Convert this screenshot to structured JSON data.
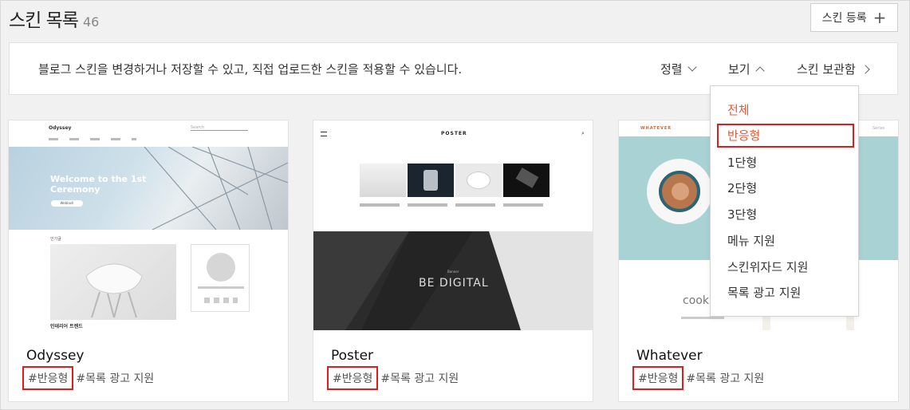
{
  "header": {
    "title": "스킨 목록",
    "count": "46",
    "register_label": "스킨 등록"
  },
  "toolbar": {
    "description": "블로그 스킨을 변경하거나 저장할 수 있고, 직접 업로드한 스킨을 적용할 수 있습니다.",
    "sort_label": "정렬",
    "view_label": "보기",
    "storage_label": "스킨 보관함"
  },
  "view_menu": {
    "items": [
      "전체",
      "반응형",
      "1단형",
      "2단형",
      "3단형",
      "메뉴 지원",
      "스킨위자드 지원",
      "목록 광고 지원"
    ]
  },
  "cards": [
    {
      "name": "Odyssey",
      "tags": [
        "#반응형",
        "#목록 광고 지원"
      ],
      "thumb": {
        "brand": "Odyssey",
        "search": "Search",
        "hero_line1": "Welcome to the 1st",
        "hero_line2": "Ceremony",
        "hero_btn": "Weblash",
        "section": "인테리어 트렌드",
        "label": "인기글"
      }
    },
    {
      "name": "Poster",
      "tags": [
        "#반응형",
        "#목록 광고 지원"
      ],
      "thumb": {
        "brand": "POSTER",
        "banner_small": "Banner",
        "banner": "BE DIGITAL"
      }
    },
    {
      "name": "Whatever",
      "tags": [
        "#반응형",
        "#목록 광고 지원"
      ],
      "thumb": {
        "brand": "WHATEVER",
        "side_label": "Series",
        "cookie": "cooki"
      }
    }
  ],
  "colors": {
    "highlight": "#e21b1b",
    "active": "#e55b3c"
  }
}
